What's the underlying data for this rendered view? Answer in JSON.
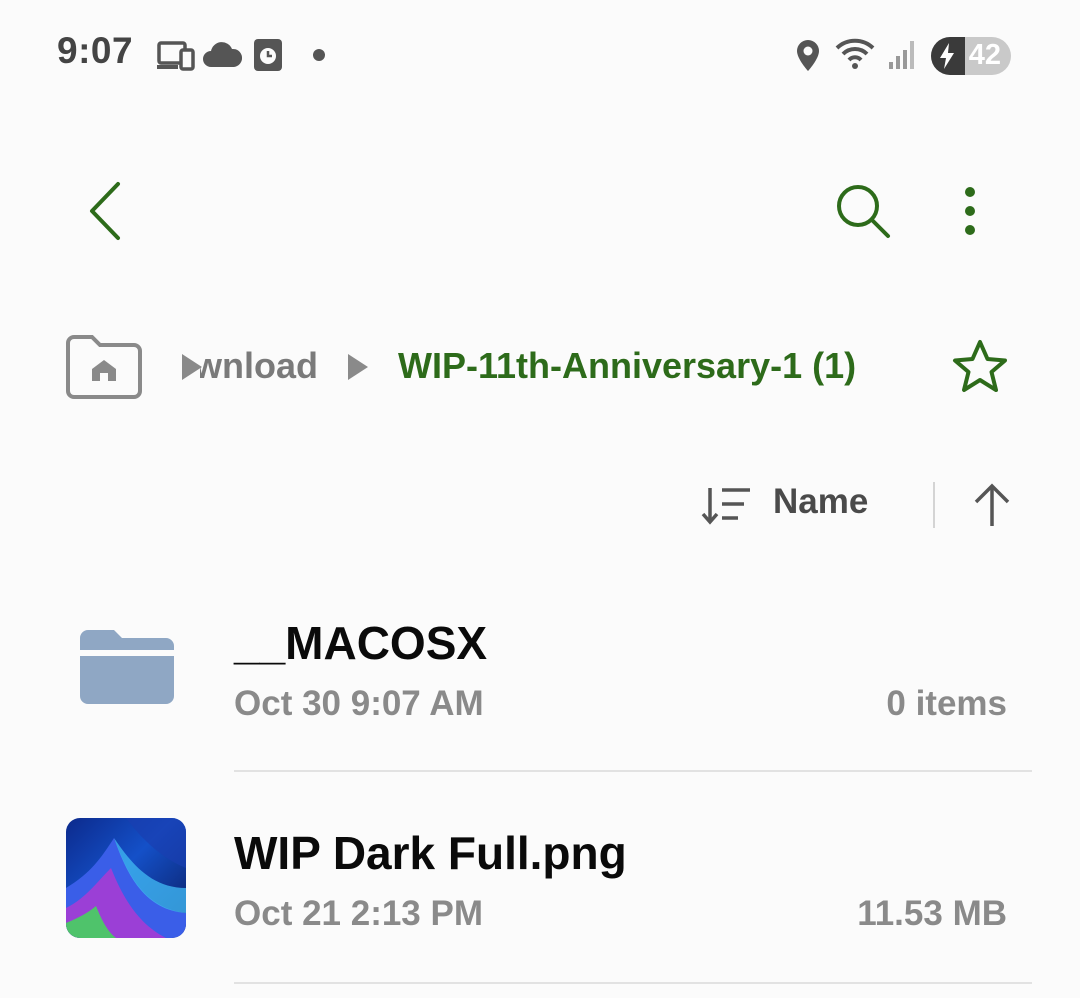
{
  "status_bar": {
    "time": "9:07",
    "battery_level": "42",
    "icons": [
      "screen-mirror-icon",
      "cloud-icon",
      "clock-app-icon",
      "dot-icon",
      "location-icon",
      "wifi-icon",
      "signal-icon",
      "battery-charging-icon"
    ]
  },
  "toolbar": {
    "back_icon": "back-arrow-icon",
    "search_icon": "search-icon",
    "more_icon": "more-options-icon"
  },
  "breadcrumb": {
    "home_icon": "home-folder-icon",
    "previous": "Download",
    "current": "WIP-11th-Anniversary-1 (1)",
    "favorite_icon": "star-icon"
  },
  "sort": {
    "label": "Name",
    "direction": "ascending"
  },
  "files": [
    {
      "name": "__MACOSX",
      "date": "Oct 30 9:07 AM",
      "info": "0 items",
      "type": "folder"
    },
    {
      "name": "WIP Dark Full.png",
      "date": "Oct 21 2:13 PM",
      "info": "11.53 MB",
      "type": "image"
    }
  ],
  "colors": {
    "accent": "#2d6b1a",
    "folder": "#8fa7c4",
    "text_secondary": "#8a8a8a"
  }
}
